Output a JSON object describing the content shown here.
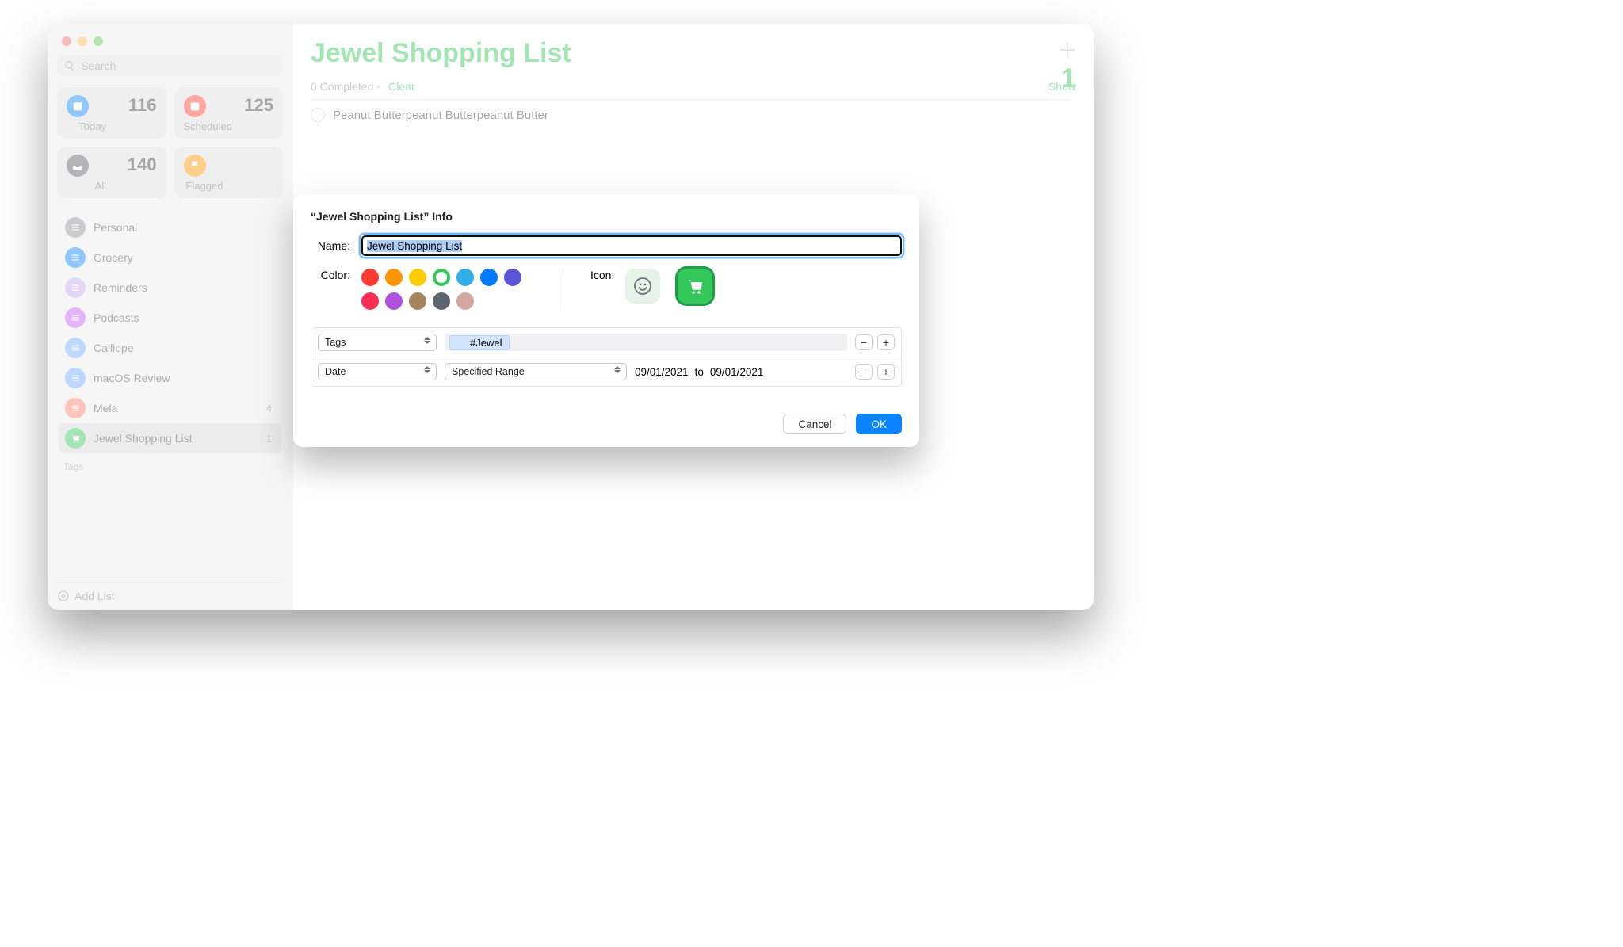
{
  "search_placeholder": "Search",
  "smart": [
    {
      "label": "Today",
      "count": "116",
      "color": "#0a84ff",
      "icon": "today"
    },
    {
      "label": "Scheduled",
      "count": "125",
      "color": "#ff3b30",
      "icon": "calendar"
    },
    {
      "label": "All",
      "count": "140",
      "color": "#5b5b60",
      "icon": "tray"
    },
    {
      "label": "Flagged",
      "count": "",
      "color": "#ff9500",
      "icon": "flag"
    }
  ],
  "lists": [
    {
      "label": "Personal",
      "color": "#8e8e93"
    },
    {
      "label": "Grocery",
      "color": "#0a84ff"
    },
    {
      "label": "Reminders",
      "color": "#c3a7e7"
    },
    {
      "label": "Podcasts",
      "color": "#bf5af2"
    },
    {
      "label": "Calliope",
      "color": "#6fa8ff"
    },
    {
      "label": "macOS Review",
      "color": "#6fa8ff"
    },
    {
      "label": "Mela",
      "color": "#ff7a68",
      "badge": "4"
    },
    {
      "label": "Jewel Shopping List",
      "color": "#34c759",
      "badge": "1",
      "selected": true,
      "cart": true
    }
  ],
  "tags_header": "Tags",
  "add_list": "Add List",
  "main": {
    "title": "Jewel Shopping List",
    "count": "1",
    "completed": "0 Completed",
    "clear": "Clear",
    "show": "Show",
    "todo": "Peanut Butterpeanut Butterpeanut Butter"
  },
  "dialog": {
    "title": "“Jewel Shopping List” Info",
    "name_label": "Name:",
    "name_value": "Jewel Shopping List",
    "color_label": "Color:",
    "icon_label": "Icon:",
    "colors": [
      "#ff3b30",
      "#ff9500",
      "#ffcc00",
      "#34c759",
      "#32ade6",
      "#007aff",
      "#5856d6",
      "#ff2d55",
      "#af52de",
      "#a2845e",
      "#5b6670",
      "#d4a7a0"
    ],
    "selected_color_index": 3,
    "filter_field": "Tags",
    "filter_tag": "#Jewel",
    "filter2_field": "Date",
    "filter2_mode": "Specified Range",
    "date_from": "09/01/2021",
    "date_sep": "to",
    "date_to": "09/01/2021",
    "cancel": "Cancel",
    "ok": "OK"
  }
}
